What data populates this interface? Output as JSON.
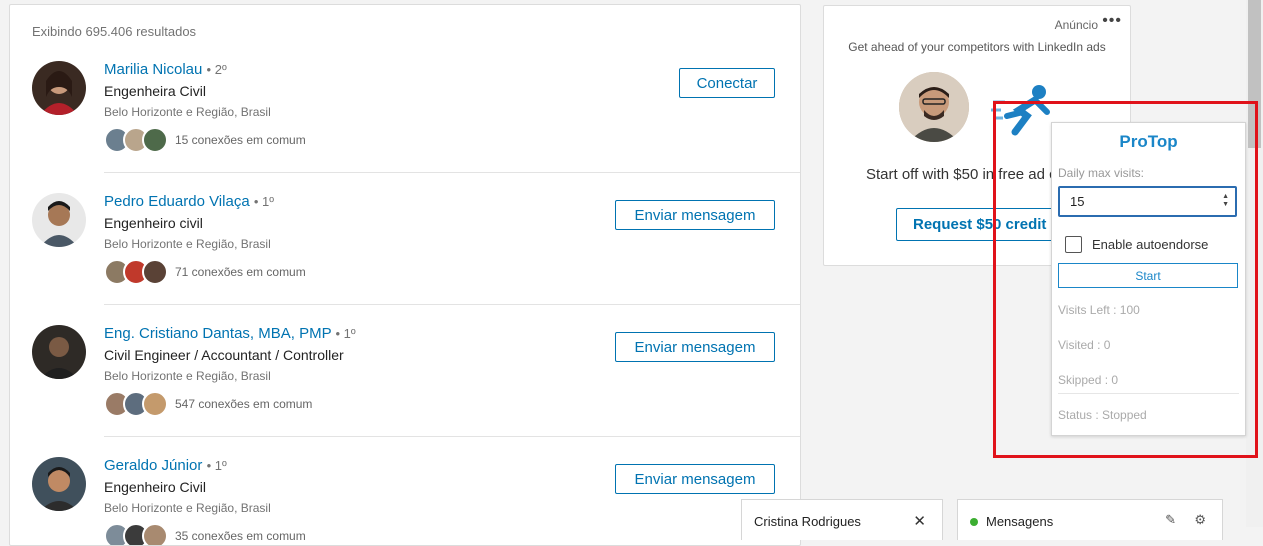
{
  "results": {
    "count_text": "Exibindo 695.406 resultados",
    "people": [
      {
        "name": "Marilia Nicolau",
        "degree": "• 2º",
        "title": "Engenheira Civil",
        "location": "Belo Horizonte e Região, Brasil",
        "connections": "15 conexões em comum",
        "action": "Conectar"
      },
      {
        "name": "Pedro Eduardo Vilaça",
        "degree": "• 1º",
        "title": "Engenheiro civil",
        "location": "Belo Horizonte e Região, Brasil",
        "connections": "71 conexões em comum",
        "action": "Enviar mensagem"
      },
      {
        "name": "Eng. Cristiano Dantas, MBA, PMP",
        "degree": "• 1º",
        "title": "Civil Engineer / Accountant / Controller",
        "location": "Belo Horizonte e Região, Brasil",
        "connections": "547 conexões em comum",
        "action": "Enviar mensagem"
      },
      {
        "name": "Geraldo Júnior",
        "degree": "• 1º",
        "title": "Engenheiro Civil",
        "location": "Belo Horizonte e Região, Brasil",
        "connections": "35 conexões em comum",
        "action": "Enviar mensagem"
      }
    ]
  },
  "ad": {
    "label": "Anúncio",
    "more": "•••",
    "tagline": "Get ahead of your competitors with LinkedIn ads",
    "offer": "Start off with $50 in free ad credit",
    "button": "Request $50 credit"
  },
  "popup": {
    "title": "ProTop",
    "daily_label": "Daily max visits:",
    "daily_value": "15",
    "autoendorse_label": "Enable autoendorse",
    "start": "Start",
    "visits_left": "Visits Left : 100",
    "visited": "Visited : 0",
    "skipped": "Skipped : 0",
    "status": "Status : Stopped"
  },
  "chat": {
    "name": "Cristina Rodrigues",
    "close": "✕"
  },
  "messaging": {
    "label": "Mensagens",
    "compose_icon": "✎",
    "settings_icon": "⚙"
  },
  "colors": {
    "link_blue": "#0073b1",
    "highlight_red": "#e0121a",
    "protop_blue": "#1a86c8",
    "online_green": "#3cae31"
  }
}
